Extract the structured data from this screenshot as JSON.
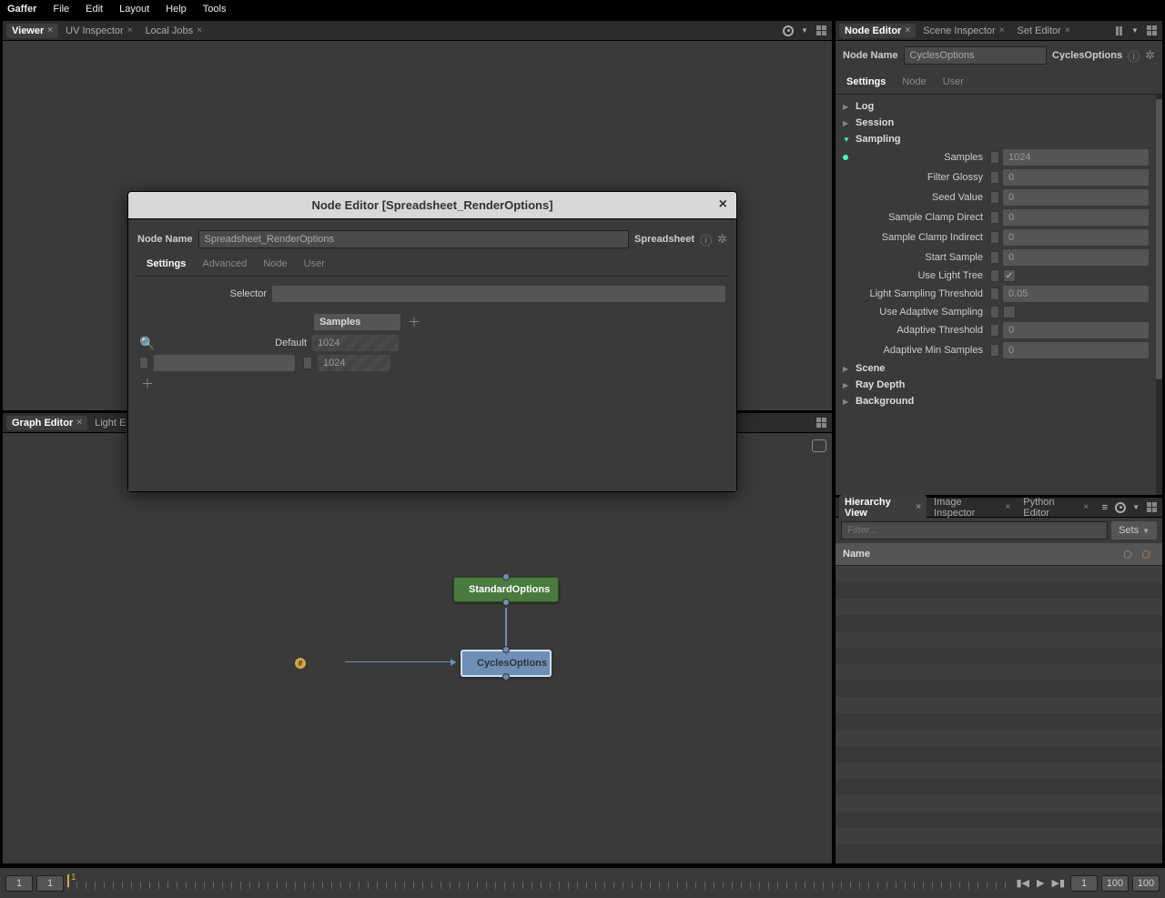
{
  "app": "Gaffer",
  "menus": [
    "File",
    "Edit",
    "Layout",
    "Help",
    "Tools"
  ],
  "left_top_tabs": [
    {
      "label": "Viewer",
      "active": true
    },
    {
      "label": "UV Inspector",
      "active": false
    },
    {
      "label": "Local Jobs",
      "active": false
    }
  ],
  "left_bottom_tabs": [
    {
      "label": "Graph Editor",
      "active": true
    },
    {
      "label": "Light E",
      "active": false
    }
  ],
  "right_top_tabs": [
    {
      "label": "Node Editor",
      "active": true
    },
    {
      "label": "Scene Inspector",
      "active": false
    },
    {
      "label": "Set Editor",
      "active": false
    }
  ],
  "right_bottom_tabs": [
    {
      "label": "Hierarchy View",
      "active": true
    },
    {
      "label": "Image Inspector",
      "active": false
    },
    {
      "label": "Python Editor",
      "active": false
    }
  ],
  "right_editor": {
    "name_label": "Node Name",
    "name_value": "CyclesOptions",
    "type": "CyclesOptions",
    "subtabs": [
      "Settings",
      "Node",
      "User"
    ],
    "sections": [
      {
        "name": "Log",
        "open": false
      },
      {
        "name": "Session",
        "open": false
      },
      {
        "name": "Sampling",
        "open": true
      },
      {
        "name": "Scene",
        "open": false
      },
      {
        "name": "Ray Depth",
        "open": false
      },
      {
        "name": "Background",
        "open": false
      }
    ],
    "sampling": [
      {
        "label": "Samples",
        "value": "1024",
        "dot": true,
        "type": "num"
      },
      {
        "label": "Filter Glossy",
        "value": "0",
        "type": "num"
      },
      {
        "label": "Seed Value",
        "value": "0",
        "type": "num"
      },
      {
        "label": "Sample Clamp Direct",
        "value": "0",
        "type": "num"
      },
      {
        "label": "Sample Clamp Indirect",
        "value": "0",
        "type": "num"
      },
      {
        "label": "Start Sample",
        "value": "0",
        "type": "num"
      },
      {
        "label": "Use Light Tree",
        "value": "",
        "type": "check",
        "checked": true
      },
      {
        "label": "Light Sampling Threshold",
        "value": "0.05",
        "type": "num"
      },
      {
        "label": "Use Adaptive Sampling",
        "value": "",
        "type": "check",
        "checked": false
      },
      {
        "label": "Adaptive Threshold",
        "value": "0",
        "type": "num"
      },
      {
        "label": "Adaptive Min Samples",
        "value": "0",
        "type": "num"
      }
    ]
  },
  "hierarchy": {
    "filter_placeholder": "Filter...",
    "sets_label": "Sets",
    "name_header": "Name"
  },
  "modal": {
    "title": "Node Editor [Spreadsheet_RenderOptions]",
    "name_label": "Node Name",
    "name_value": "Spreadsheet_RenderOptions",
    "type": "Spreadsheet",
    "subtabs": [
      "Settings",
      "Advanced",
      "Node",
      "User"
    ],
    "selector_label": "Selector",
    "col_header": "Samples",
    "default_label": "Default",
    "default_value": "1024",
    "row2_value": "1024"
  },
  "graph": {
    "node1": "StandardOptions",
    "node2": "CyclesOptions",
    "badge": "#"
  },
  "timeline": {
    "start": "1",
    "cur": "1",
    "in": "1",
    "end": "100",
    "out": "100"
  }
}
